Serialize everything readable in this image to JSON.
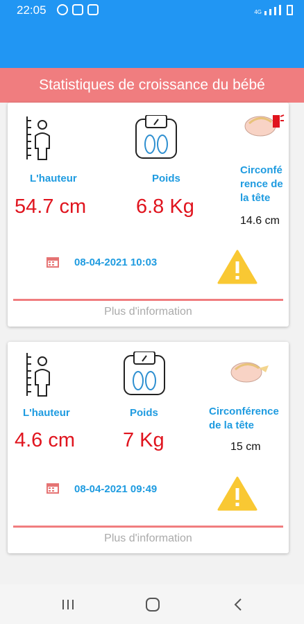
{
  "status_bar": {
    "time": "22:05",
    "network": "4G"
  },
  "title": "Statistiques de croissance du bébé",
  "cards": [
    {
      "height_label": "L'hauteur",
      "height_value": "54.7 cm",
      "weight_label": "Poids",
      "weight_value": "6.8 Kg",
      "head_label": "Circonfé rence de la tête",
      "head_value": "14.6 cm",
      "date": "08-04-2021 10:03",
      "more": "Plus d'information"
    },
    {
      "height_label": "L'hauteur",
      "height_value": "4.6 cm",
      "weight_label": "Poids",
      "weight_value": "7 Kg",
      "head_label": "Circonférence de la tête",
      "head_value": "15 cm",
      "date": "08-04-2021 09:49",
      "more": "Plus d'information"
    }
  ],
  "icons": {
    "height": "height-measure-icon",
    "weight": "scale-icon",
    "head": "baby-head-icon",
    "calendar": "calendar-icon",
    "warning": "warning-icon"
  },
  "colors": {
    "app_bar": "#2196F3",
    "title_bar": "#F07D7F",
    "label_blue": "#1E9BE0",
    "value_red": "#E0141E",
    "warning_yellow": "#F9C833"
  }
}
